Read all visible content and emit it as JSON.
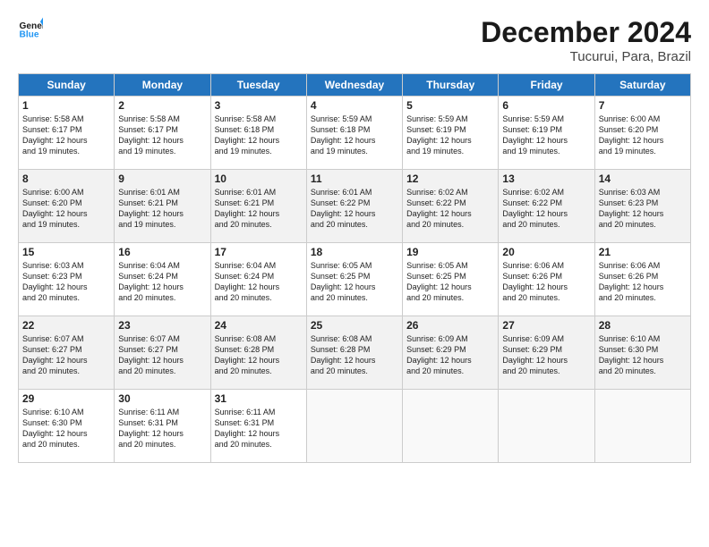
{
  "logo": {
    "line1": "General",
    "line2": "Blue"
  },
  "title": "December 2024",
  "location": "Tucurui, Para, Brazil",
  "days_of_week": [
    "Sunday",
    "Monday",
    "Tuesday",
    "Wednesday",
    "Thursday",
    "Friday",
    "Saturday"
  ],
  "weeks": [
    [
      {
        "day": "1",
        "info": "Sunrise: 5:58 AM\nSunset: 6:17 PM\nDaylight: 12 hours\nand 19 minutes."
      },
      {
        "day": "2",
        "info": "Sunrise: 5:58 AM\nSunset: 6:17 PM\nDaylight: 12 hours\nand 19 minutes."
      },
      {
        "day": "3",
        "info": "Sunrise: 5:58 AM\nSunset: 6:18 PM\nDaylight: 12 hours\nand 19 minutes."
      },
      {
        "day": "4",
        "info": "Sunrise: 5:59 AM\nSunset: 6:18 PM\nDaylight: 12 hours\nand 19 minutes."
      },
      {
        "day": "5",
        "info": "Sunrise: 5:59 AM\nSunset: 6:19 PM\nDaylight: 12 hours\nand 19 minutes."
      },
      {
        "day": "6",
        "info": "Sunrise: 5:59 AM\nSunset: 6:19 PM\nDaylight: 12 hours\nand 19 minutes."
      },
      {
        "day": "7",
        "info": "Sunrise: 6:00 AM\nSunset: 6:20 PM\nDaylight: 12 hours\nand 19 minutes."
      }
    ],
    [
      {
        "day": "8",
        "info": "Sunrise: 6:00 AM\nSunset: 6:20 PM\nDaylight: 12 hours\nand 19 minutes."
      },
      {
        "day": "9",
        "info": "Sunrise: 6:01 AM\nSunset: 6:21 PM\nDaylight: 12 hours\nand 19 minutes."
      },
      {
        "day": "10",
        "info": "Sunrise: 6:01 AM\nSunset: 6:21 PM\nDaylight: 12 hours\nand 20 minutes."
      },
      {
        "day": "11",
        "info": "Sunrise: 6:01 AM\nSunset: 6:22 PM\nDaylight: 12 hours\nand 20 minutes."
      },
      {
        "day": "12",
        "info": "Sunrise: 6:02 AM\nSunset: 6:22 PM\nDaylight: 12 hours\nand 20 minutes."
      },
      {
        "day": "13",
        "info": "Sunrise: 6:02 AM\nSunset: 6:22 PM\nDaylight: 12 hours\nand 20 minutes."
      },
      {
        "day": "14",
        "info": "Sunrise: 6:03 AM\nSunset: 6:23 PM\nDaylight: 12 hours\nand 20 minutes."
      }
    ],
    [
      {
        "day": "15",
        "info": "Sunrise: 6:03 AM\nSunset: 6:23 PM\nDaylight: 12 hours\nand 20 minutes."
      },
      {
        "day": "16",
        "info": "Sunrise: 6:04 AM\nSunset: 6:24 PM\nDaylight: 12 hours\nand 20 minutes."
      },
      {
        "day": "17",
        "info": "Sunrise: 6:04 AM\nSunset: 6:24 PM\nDaylight: 12 hours\nand 20 minutes."
      },
      {
        "day": "18",
        "info": "Sunrise: 6:05 AM\nSunset: 6:25 PM\nDaylight: 12 hours\nand 20 minutes."
      },
      {
        "day": "19",
        "info": "Sunrise: 6:05 AM\nSunset: 6:25 PM\nDaylight: 12 hours\nand 20 minutes."
      },
      {
        "day": "20",
        "info": "Sunrise: 6:06 AM\nSunset: 6:26 PM\nDaylight: 12 hours\nand 20 minutes."
      },
      {
        "day": "21",
        "info": "Sunrise: 6:06 AM\nSunset: 6:26 PM\nDaylight: 12 hours\nand 20 minutes."
      }
    ],
    [
      {
        "day": "22",
        "info": "Sunrise: 6:07 AM\nSunset: 6:27 PM\nDaylight: 12 hours\nand 20 minutes."
      },
      {
        "day": "23",
        "info": "Sunrise: 6:07 AM\nSunset: 6:27 PM\nDaylight: 12 hours\nand 20 minutes."
      },
      {
        "day": "24",
        "info": "Sunrise: 6:08 AM\nSunset: 6:28 PM\nDaylight: 12 hours\nand 20 minutes."
      },
      {
        "day": "25",
        "info": "Sunrise: 6:08 AM\nSunset: 6:28 PM\nDaylight: 12 hours\nand 20 minutes."
      },
      {
        "day": "26",
        "info": "Sunrise: 6:09 AM\nSunset: 6:29 PM\nDaylight: 12 hours\nand 20 minutes."
      },
      {
        "day": "27",
        "info": "Sunrise: 6:09 AM\nSunset: 6:29 PM\nDaylight: 12 hours\nand 20 minutes."
      },
      {
        "day": "28",
        "info": "Sunrise: 6:10 AM\nSunset: 6:30 PM\nDaylight: 12 hours\nand 20 minutes."
      }
    ],
    [
      {
        "day": "29",
        "info": "Sunrise: 6:10 AM\nSunset: 6:30 PM\nDaylight: 12 hours\nand 20 minutes."
      },
      {
        "day": "30",
        "info": "Sunrise: 6:11 AM\nSunset: 6:31 PM\nDaylight: 12 hours\nand 20 minutes."
      },
      {
        "day": "31",
        "info": "Sunrise: 6:11 AM\nSunset: 6:31 PM\nDaylight: 12 hours\nand 20 minutes."
      },
      null,
      null,
      null,
      null
    ]
  ]
}
